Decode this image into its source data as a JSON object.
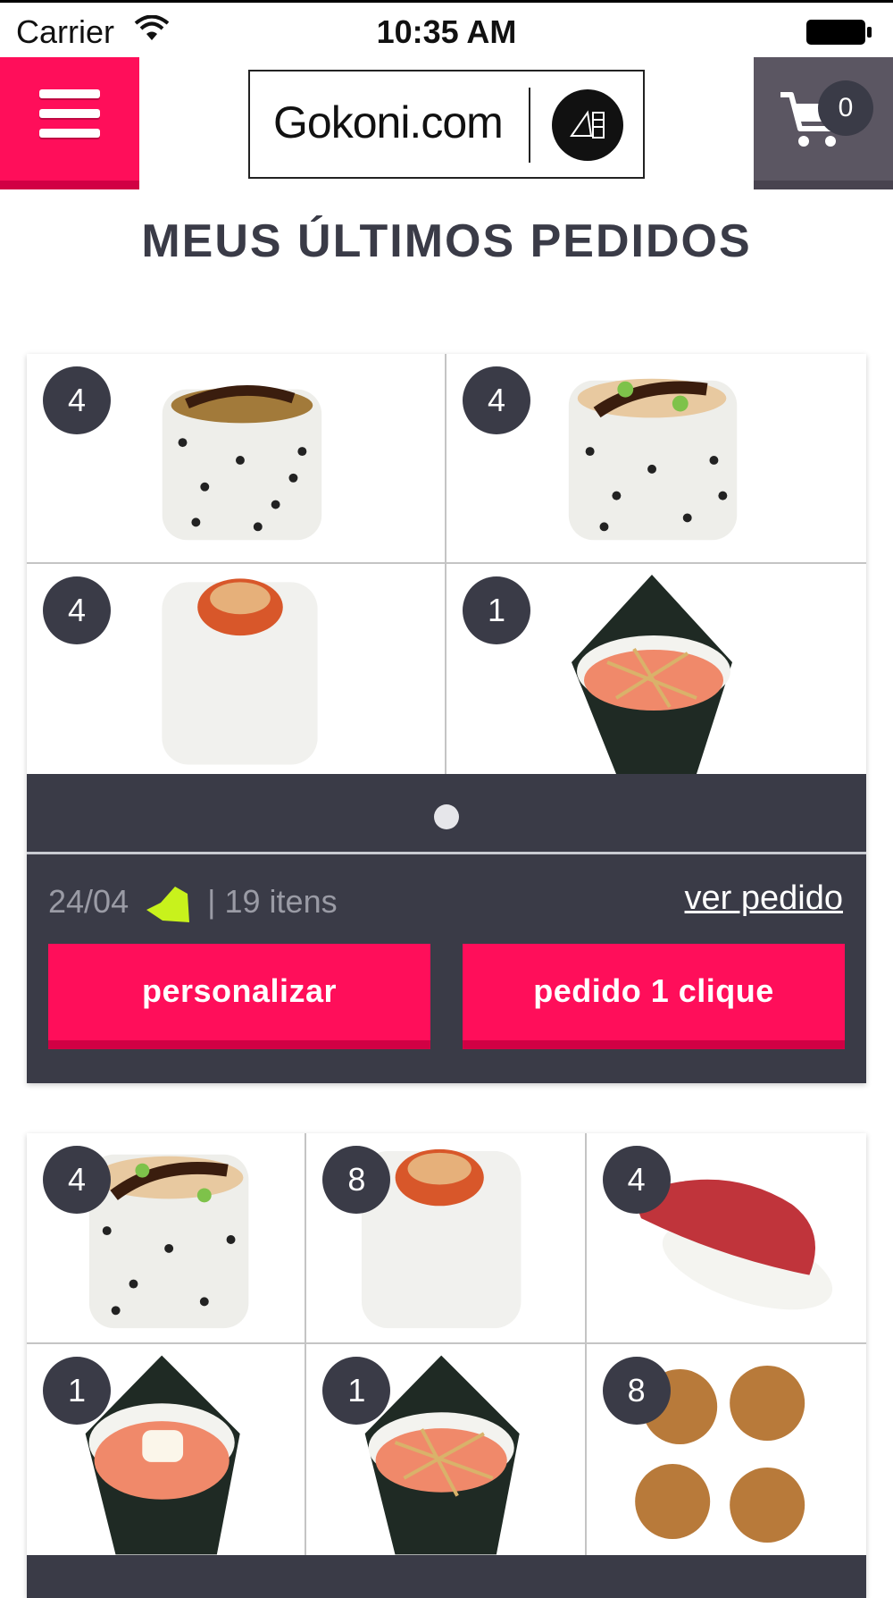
{
  "status_bar": {
    "carrier": "Carrier",
    "time": "10:35 AM"
  },
  "header": {
    "logo_text": "Gokoni.com",
    "cart_count": "0"
  },
  "page_title": "MEUS ÚLTIMOS PEDIDOS",
  "orders": [
    {
      "items": [
        {
          "qty": "4",
          "name": "sesame roll"
        },
        {
          "qty": "4",
          "name": "sesame roll"
        },
        {
          "qty": "4",
          "name": "rice roll"
        },
        {
          "qty": "1",
          "name": "temaki"
        }
      ],
      "date": "24/04",
      "items_count": "19 itens",
      "view_label": "ver pedido",
      "personalize_label": "personalizar",
      "one_click_label": "pedido 1 clique"
    },
    {
      "items": [
        {
          "qty": "4",
          "name": "sesame roll"
        },
        {
          "qty": "8",
          "name": "rice roll"
        },
        {
          "qty": "4",
          "name": "tuna nigiri"
        },
        {
          "qty": "1",
          "name": "salmon temaki"
        },
        {
          "qty": "1",
          "name": "temaki"
        },
        {
          "qty": "8",
          "name": "fried balls"
        }
      ]
    }
  ],
  "colors": {
    "accent": "#ff0e5a",
    "dark": "#3a3b47",
    "cart_bg": "#5b5662",
    "leaf": "#c8f21c"
  }
}
